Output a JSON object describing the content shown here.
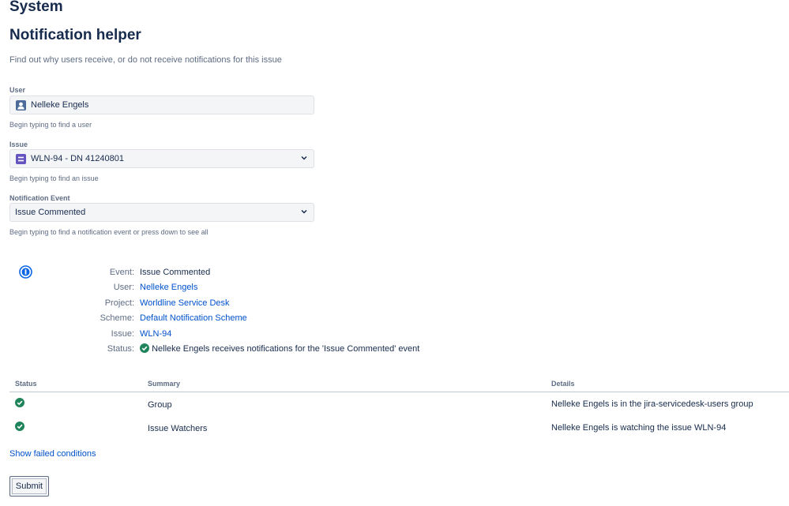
{
  "header": {
    "system": "System",
    "title": "Notification helper",
    "description": "Find out why users receive, or do not receive notifications for this issue"
  },
  "form": {
    "user": {
      "label": "User",
      "value": "Nelleke Engels",
      "hint": "Begin typing to find a user",
      "icon": "user-avatar-icon"
    },
    "issue": {
      "label": "Issue",
      "value": "WLN-94 - DN 41240801",
      "hint": "Begin typing to find an issue",
      "icon": "issue-type-icon"
    },
    "event": {
      "label": "Notification Event",
      "value": "Issue Commented",
      "hint": "Begin typing to find a notification event or press down to see all"
    }
  },
  "result": {
    "icon": "info-icon",
    "rows": [
      {
        "key": "Event:",
        "value": "Issue Commented"
      },
      {
        "key": "User:",
        "value": "Nelleke Engels"
      },
      {
        "key": "Project:",
        "value": "Worldline Service Desk"
      },
      {
        "key": "Scheme:",
        "value": "Default Notification Scheme"
      },
      {
        "key": "Issue:",
        "value": "WLN-94"
      },
      {
        "key": "Status:",
        "value": "Nelleke Engels receives notifications for the 'Issue Commented' event"
      }
    ]
  },
  "table": {
    "headers": {
      "status": "Status",
      "summary": "Summary",
      "details": "Details"
    },
    "rows": [
      {
        "summary": "Group",
        "details": "Nelleke Engels is in the jira-servicedesk-users group"
      },
      {
        "summary": "Issue Watchers",
        "details": "Nelleke Engels is watching the issue WLN-94"
      }
    ]
  },
  "links": {
    "show_failed": "Show failed conditions"
  },
  "buttons": {
    "submit": "Submit"
  },
  "colors": {
    "link": "#0052cc",
    "success": "#1f845a",
    "info": "#0c66e4",
    "issue_type": "#6554c0",
    "avatar": "#4c6b9a"
  }
}
